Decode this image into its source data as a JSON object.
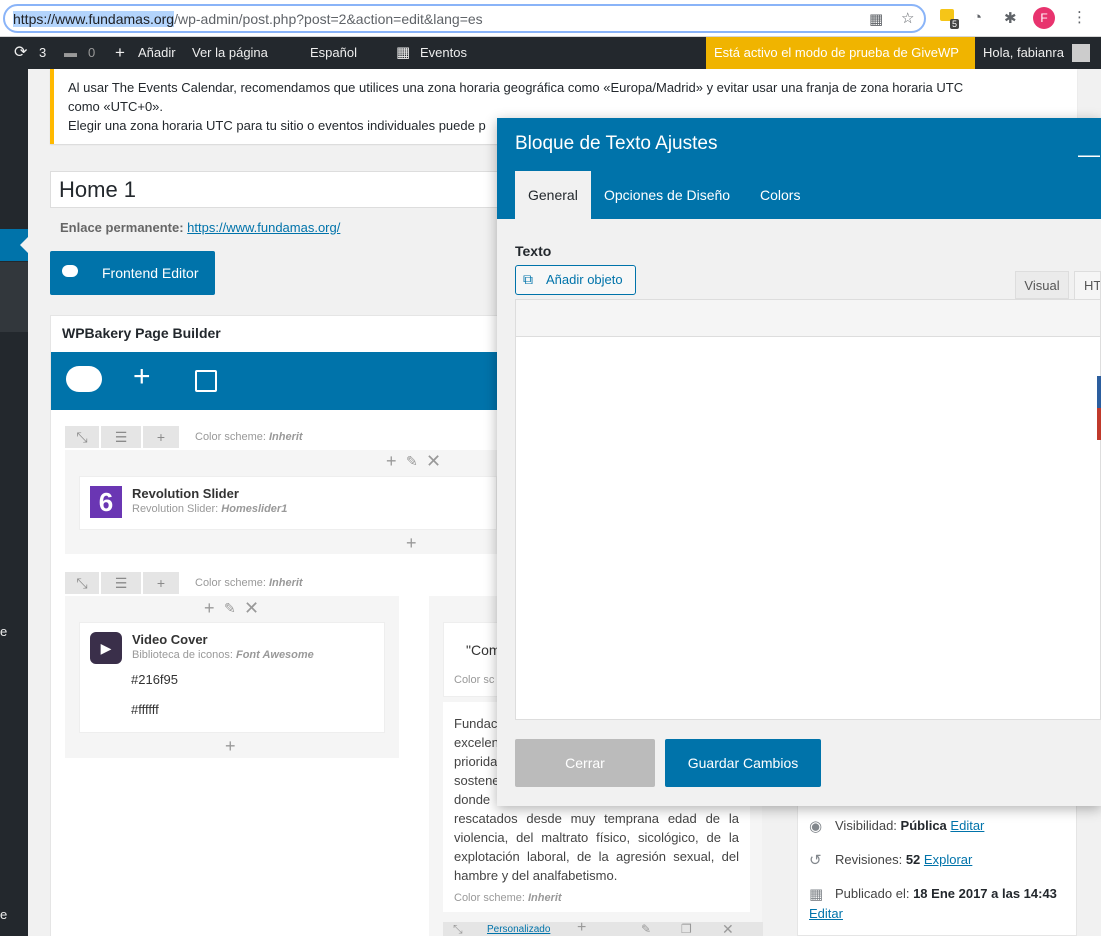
{
  "browser": {
    "url_host": "https://www.fundamas.org",
    "url_path": "/wp-admin/post.php?post=2&action=edit&lang=es",
    "extension_badge": "5",
    "profile_initial": "F"
  },
  "adminbar": {
    "updates_count": "3",
    "comments_count": "0",
    "add_label": "Añadir",
    "view_page": "Ver la página",
    "language": "Español",
    "help_glyph": "?",
    "events": "Eventos",
    "givewp_notice": "Está activo el modo de prueba de GiveWP",
    "greeting": "Hola, fabianra"
  },
  "notice": {
    "line1": "Al usar The Events Calendar, recomendamos que utilices una zona horaria geográfica como «Europa/Madrid» y evitar usar una franja de zona horaria UTC",
    "line2": "como «UTC+0».",
    "line3": "Elegir una zona horaria UTC para tu sitio o eventos individuales puede p"
  },
  "post": {
    "title": "Home 1",
    "permalink_label": "Enlace permanente:",
    "permalink_url": "https://www.fundamas.org/",
    "frontend_button": "Frontend Editor"
  },
  "wpbakery": {
    "title": "WPBakery Page Builder",
    "scheme_label": "Color scheme:",
    "scheme_value": "Inherit",
    "rows": [
      {
        "name": "Revolution Slider",
        "sub_label": "Revolution Slider:",
        "sub_value": "Homeslider1"
      },
      {
        "name": "Video Cover",
        "sub_label": "Biblioteca de iconos:",
        "sub_value": "Font Awesome",
        "color1": "#216f95",
        "color2": "#ffffff"
      }
    ],
    "quote_start": "\"Com",
    "scheme_cut": "Color sc",
    "text_lines": [
      "Fundac",
      "excelen",
      "priorida",
      "sostene",
      "donde"
    ],
    "text_full": "rescatados desde muy temprana edad de la violencia, del maltrato físico, sicológico, de la explotación laboral, de la agresión sexual, del hambre y del analfabetismo.",
    "bottom_scheme_label": "Color scheme:",
    "bottom_scheme_value": "Inherit",
    "personalizado": "Personalizado"
  },
  "publish": {
    "visibility_label": "Visibilidad:",
    "visibility_value": "Pública",
    "edit": "Editar",
    "revisions_label": "Revisiones:",
    "revisions_value": "52",
    "explore": "Explorar",
    "published_label": "Publicado el:",
    "published_value": "18 Ene 2017 a las 14:43",
    "edit2": "Editar"
  },
  "modal": {
    "title": "Bloque de Texto Ajustes",
    "tabs": [
      "General",
      "Opciones de Diseño",
      "Colors"
    ],
    "texto_label": "Texto",
    "add_object": "Añadir objeto",
    "visual_tab": "Visual",
    "html_tab": "HT",
    "close_button": "Cerrar",
    "save_button": "Guardar Cambios"
  },
  "colors": {
    "wp_blue": "#0073aa",
    "admin_dark": "#23282d",
    "givewp_yellow": "#f0b400",
    "notice_border": "#ffb900"
  }
}
